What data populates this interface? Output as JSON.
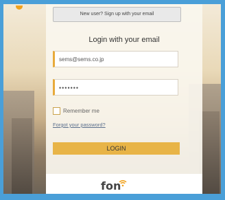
{
  "signup": {
    "label": "New user? Sign up with your email"
  },
  "login": {
    "title": "Login with your email",
    "email_value": "sems@sems.co.jp",
    "password_value": "•••••••",
    "remember_label": "Remember me",
    "forgot_label": "Forgot your password?",
    "login_label": "LOGIN"
  },
  "footer": {
    "logo_text": "fon"
  },
  "colors": {
    "accent": "#e8b447",
    "brand_orange": "#f0a21e",
    "frame_blue": "#4a9fd8"
  }
}
